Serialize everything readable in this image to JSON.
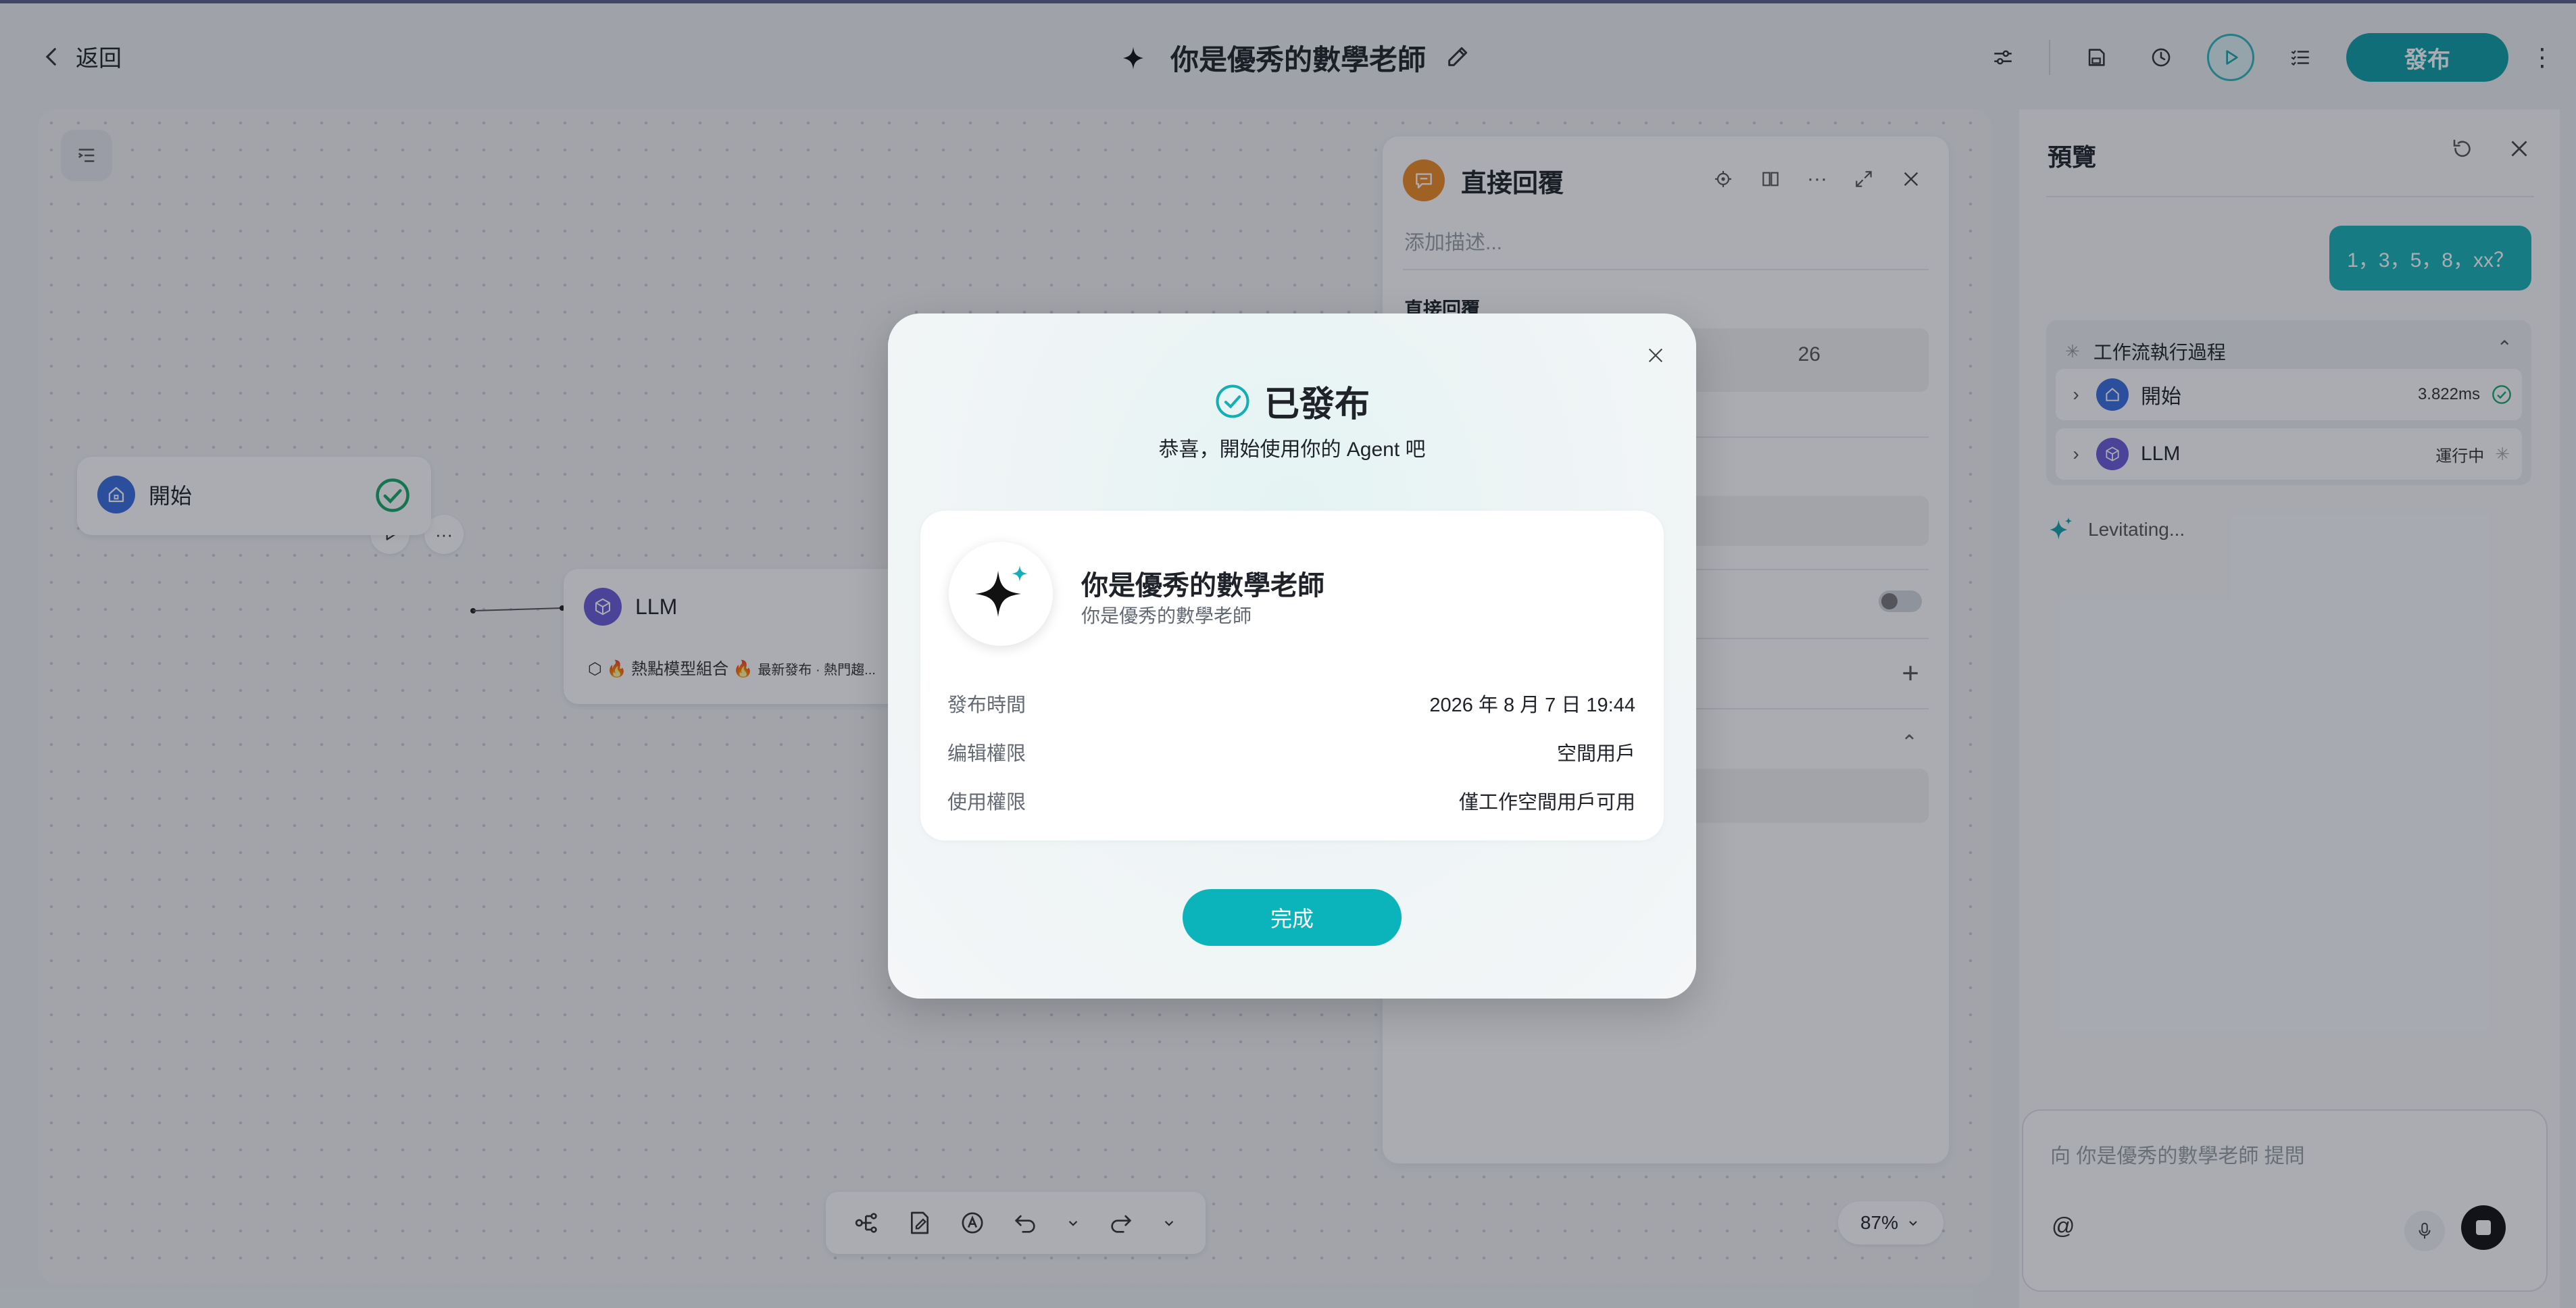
{
  "topbar": {
    "back_label": "返回",
    "title": "你是優秀的數學老師",
    "publish_label": "發布"
  },
  "canvas": {
    "start_node": {
      "label": "開始"
    },
    "llm_node": {
      "label": "LLM",
      "model": "🔥 熱點模型組合 🔥",
      "model_tag": "最新發布 · 熱門趨..."
    },
    "zoom": "87%"
  },
  "panel": {
    "title": "直接回覆",
    "description_placeholder": "添加描述...",
    "section_label": "直接回覆",
    "count": "26"
  },
  "preview": {
    "title": "預覽",
    "user_message": "1，3，5，8，xx？",
    "workflow_header": "工作流執行過程",
    "steps": [
      {
        "name": "開始",
        "meta": "3.822ms",
        "status": "done"
      },
      {
        "name": "LLM",
        "meta": "運行中",
        "status": "running"
      }
    ],
    "status_text": "Levitating...",
    "input_placeholder": "向 你是優秀的數學老師 提問",
    "at_symbol": "@"
  },
  "modal": {
    "title": "已發布",
    "subtitle": "恭喜，開始使用你的 Agent 吧",
    "agent_name": "你是優秀的數學老師",
    "agent_desc": "你是優秀的數學老師",
    "rows": [
      {
        "key": "發布時間",
        "value": "2026 年 8 月 7 日 19:44"
      },
      {
        "key": "编辑權限",
        "value": "空間用戶"
      },
      {
        "key": "使用權限",
        "value": "僅工作空間用戶可用"
      }
    ],
    "done_label": "完成"
  },
  "colors": {
    "accent": "#0bb3bb",
    "publish": "#0e9ea6",
    "panel_icon": "#f08a24",
    "start_icon": "#3b6ee0",
    "llm_icon": "#6b5bd6"
  }
}
